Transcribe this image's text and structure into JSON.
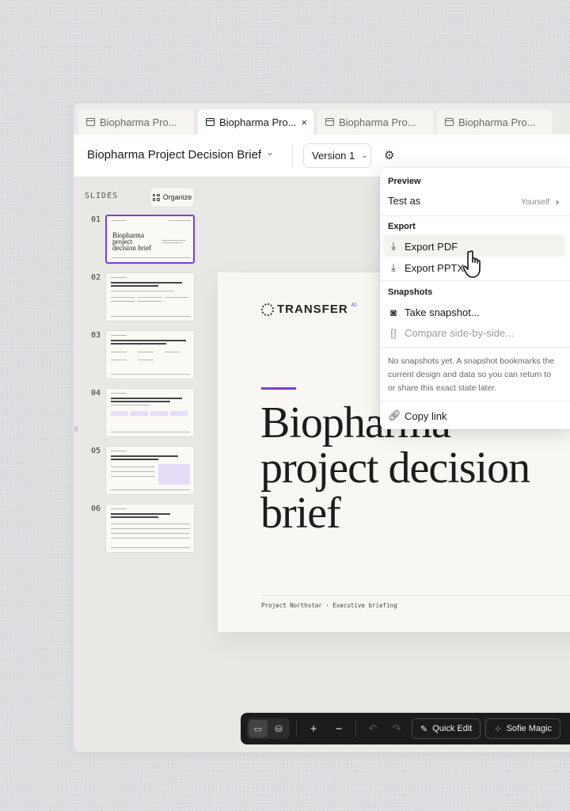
{
  "tabs": [
    {
      "label": "Biopharma Pro..."
    },
    {
      "label": "Biopharma Pro...",
      "close": "×"
    },
    {
      "label": "Biopharma Pro..."
    },
    {
      "label": "Biopharma Pro..."
    }
  ],
  "header": {
    "title": "Biopharma Project Decision Brief",
    "version_label": "Version 1"
  },
  "slides_panel": {
    "label": "SLIDES",
    "organize_label": "Organize",
    "thumbs": [
      {
        "num": "01",
        "title": "Biopharma project decision brief"
      },
      {
        "num": "02"
      },
      {
        "num": "03"
      },
      {
        "num": "04"
      },
      {
        "num": "05"
      },
      {
        "num": "06"
      }
    ]
  },
  "slide": {
    "logo_text": "TRANSFER",
    "logo_sup": "AI",
    "title": "Biopharma project decision brief",
    "footer": "Project Northstar · Executive briefing"
  },
  "toolbar": {
    "quick_edit": "Quick Edit",
    "sofie_magic": "Sofie Magic"
  },
  "menu": {
    "preview_heading": "Preview",
    "test_as_label": "Test as",
    "test_as_value": "Yourself",
    "export_heading": "Export",
    "export_pdf": "Export PDF",
    "export_pptx": "Export PPTX",
    "snapshots_heading": "Snapshots",
    "take_snapshot": "Take snapshot...",
    "compare": "Compare side-by-side...",
    "note": "No snapshots yet. A snapshot bookmarks the current design and data so you can return to or share this exact state later.",
    "copy_link": "Copy link"
  },
  "colors": {
    "accent": "#7a3fd6",
    "toolbar_bg": "#1c1c1c"
  }
}
